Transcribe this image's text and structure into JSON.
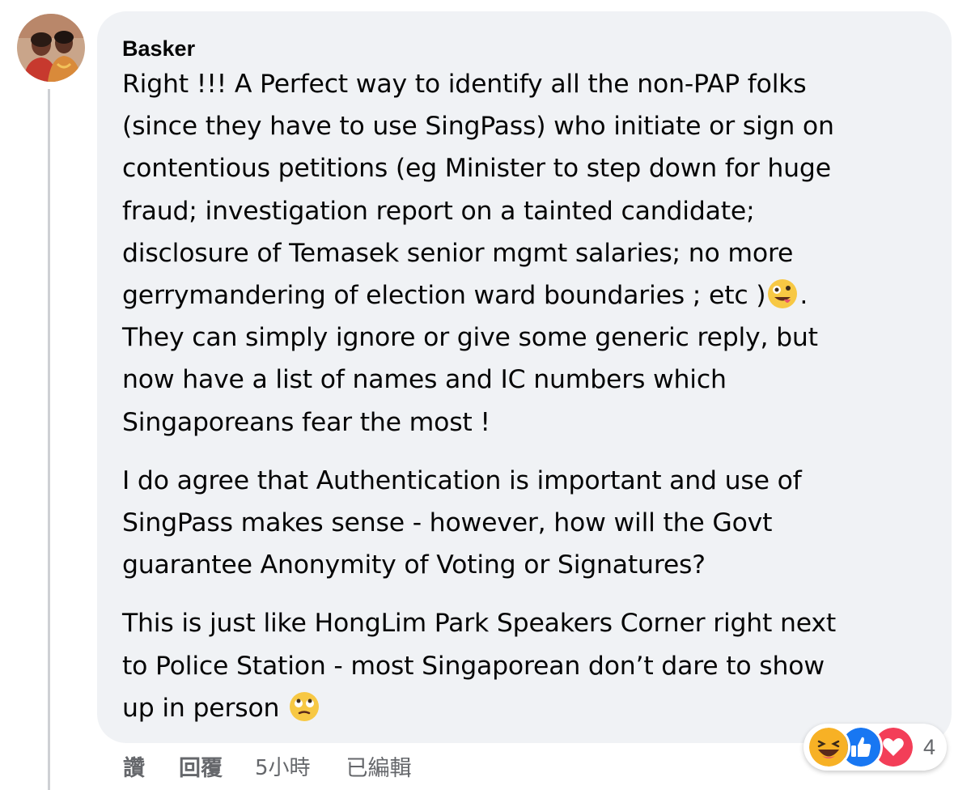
{
  "comment": {
    "author": "Basker",
    "avatar": "profile-photo-avatar",
    "paragraphs": [
      "Right !!! A Perfect way to identify all the non-PAP folks\n(since they have to use SingPass) who initiate or sign on\ncontentious petitions (eg Minister to step down for huge\nfraud; investigation report on a tainted candidate;\ndisclosure of Temasek senior mgmt salaries; no more\ngerrymandering of election ward boundaries ; etc )",
      ".\nThey can simply ignore or give some generic reply, but\nnow have a list of names and IC numbers which\nSingaporeans fear the most !",
      "I do agree that Authentication is important and use of\nSingPass makes sense - however, how will the Govt\nguarantee Anonymity of Voting or Signatures?",
      "This is just like HongLim Park Speakers Corner right next\nto Police Station - most Singaporean don’t dare to show\nup in person "
    ],
    "emojis": [
      "zany-face-emoji",
      "rolling-eyes-emoji"
    ]
  },
  "reactions": {
    "icons": [
      "haha-reaction-icon",
      "like-reaction-icon",
      "love-reaction-icon"
    ],
    "count": "4"
  },
  "actions": {
    "like": "讚",
    "reply": "回覆",
    "time": "5小時",
    "edited": "已編輯"
  },
  "colors": {
    "bubble": "#f0f2f5",
    "text": "#050505",
    "secondary": "#65676b",
    "like_blue": "#1877f2",
    "love_red": "#f33e58",
    "haha_yellow": "#f7b125"
  }
}
